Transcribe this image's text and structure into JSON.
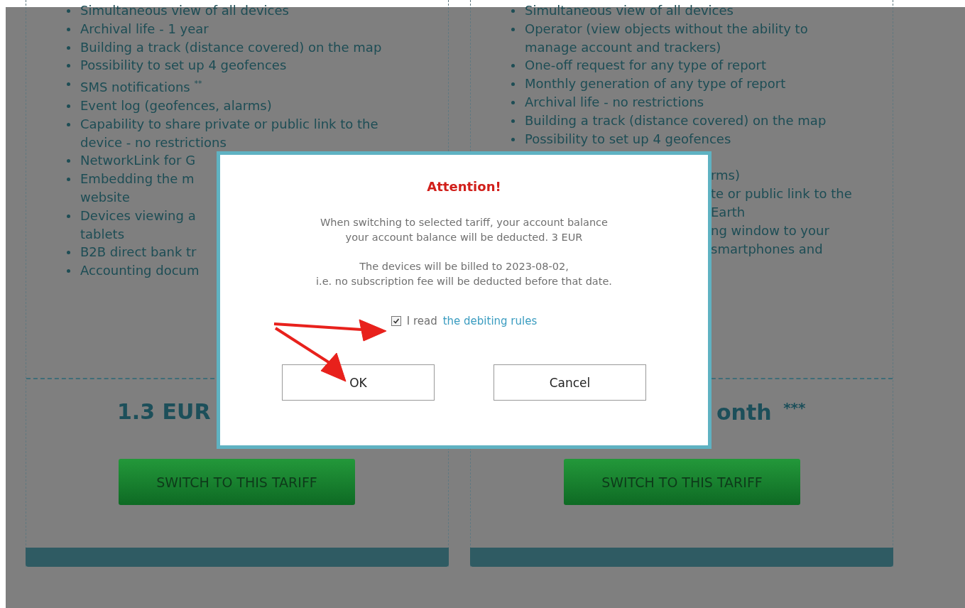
{
  "left_plan": {
    "features": [
      {
        "text": "Simultaneous view of all devices"
      },
      {
        "text": "Archival life - 1 year"
      },
      {
        "text": "Building a track (distance covered) on the map"
      },
      {
        "text": "Possibility to set up 4 geofences"
      },
      {
        "text": "SMS notifications $^{**}$"
      },
      {
        "text": "Event log (geofences, alarms)"
      },
      {
        "text": "Capability to share private or public link to the\ndevice - no restrictions"
      },
      {
        "text": "NetworkLink for G"
      },
      {
        "text": "Embedding the m\nwebsite"
      },
      {
        "text": "Devices viewing a\ntablets"
      },
      {
        "text": "B2B direct bank tr"
      },
      {
        "text": "Accounting docum"
      }
    ],
    "price": "1.3 EUR",
    "button": "SWITCH TO THIS TARIFF"
  },
  "right_plan": {
    "features": [
      {
        "text": "Simultaneous view of all devices",
        "kind": "bullet"
      },
      {
        "text": "Operator (view objects without the ability to\nmanage account and trackers)",
        "kind": "bullet"
      },
      {
        "text": "One-off request for any type of report",
        "kind": "bullet"
      },
      {
        "text": "Monthly generation of any type of report",
        "kind": "bullet"
      },
      {
        "text": "Archival life - no restrictions",
        "kind": "bullet"
      },
      {
        "text": "Building a track (distance covered) on the map",
        "kind": "bullet"
      },
      {
        "text": "Possibility to set up 4 geofences",
        "kind": "bullet"
      },
      {
        "text": "rms)",
        "kind": "fragment"
      },
      {
        "text": "te or public link to the",
        "kind": "fragment"
      },
      {
        "text": "Earth",
        "kind": "fragment"
      },
      {
        "text": "ng window to your",
        "kind": "fragment"
      },
      {
        "text": "smartphones and",
        "kind": "fragment"
      }
    ],
    "price": "onth $^{***}$",
    "button": "SWITCH TO THIS TARIFF"
  },
  "dialog": {
    "title": "Attention!",
    "paragraphs": [
      "When switching to selected tariff, your account balance\nyour account balance will be deducted. 3 EUR",
      "The devices will be billed to 2023-08-02,\ni.e. no subscription fee will be deducted before that date."
    ],
    "checkbox": {
      "checked": true,
      "label": "I read",
      "link": "the debiting rules"
    },
    "buttons": [
      {
        "label": "OK"
      },
      {
        "label": "Cancel"
      }
    ]
  }
}
